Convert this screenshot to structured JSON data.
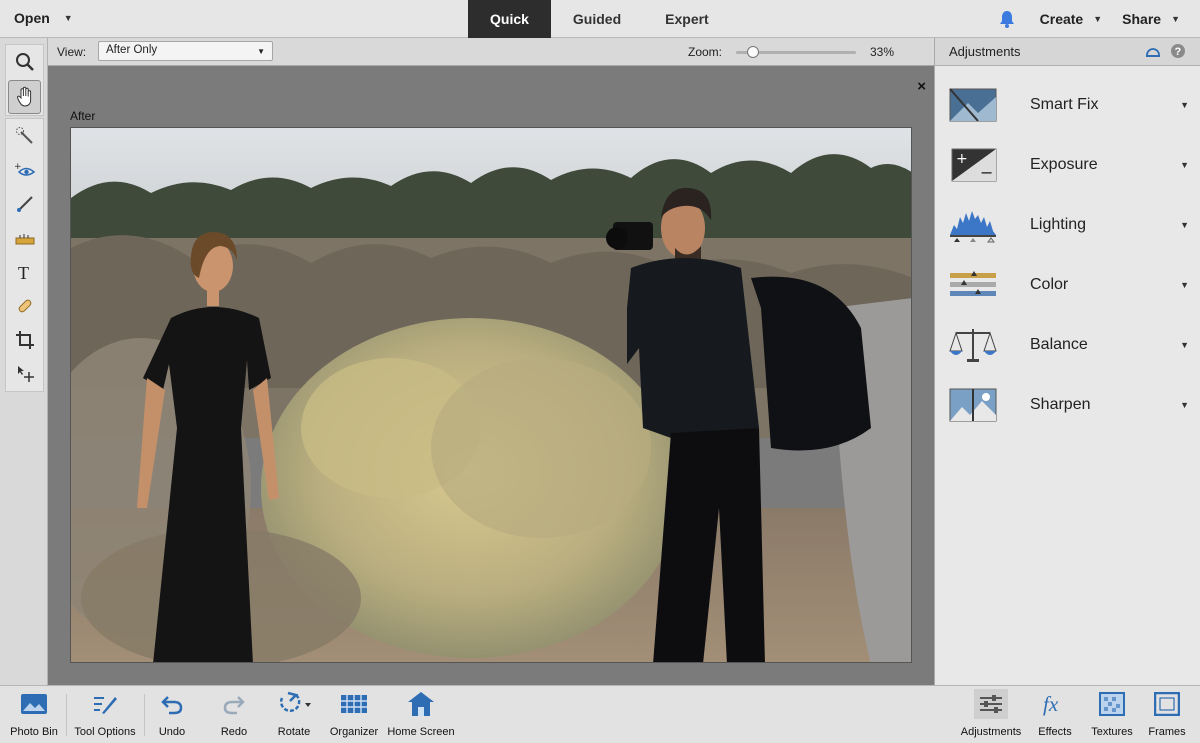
{
  "menubar": {
    "open_label": "Open",
    "mode_tabs": [
      {
        "label": "Quick",
        "active": true
      },
      {
        "label": "Guided",
        "active": false
      },
      {
        "label": "Expert",
        "active": false
      }
    ],
    "create_label": "Create",
    "share_label": "Share"
  },
  "options": {
    "view_label": "View:",
    "view_value": "After Only",
    "zoom_label": "Zoom:",
    "zoom_value": "33%",
    "zoom_fraction": 0.1
  },
  "canvas": {
    "after_label": "After",
    "close_glyph": "×"
  },
  "adjustments": {
    "title": "Adjustments",
    "items": [
      {
        "label": "Smart Fix",
        "icon": "smart-fix-icon"
      },
      {
        "label": "Exposure",
        "icon": "exposure-icon"
      },
      {
        "label": "Lighting",
        "icon": "lighting-icon"
      },
      {
        "label": "Color",
        "icon": "color-icon"
      },
      {
        "label": "Balance",
        "icon": "balance-icon"
      },
      {
        "label": "Sharpen",
        "icon": "sharpen-icon"
      }
    ]
  },
  "bottombar": {
    "left": [
      {
        "label": "Photo Bin",
        "icon": "photo-bin-icon"
      },
      {
        "label": "Tool Options",
        "icon": "tool-options-icon"
      },
      {
        "label": "Undo",
        "icon": "undo-icon"
      },
      {
        "label": "Redo",
        "icon": "redo-icon"
      },
      {
        "label": "Rotate",
        "icon": "rotate-icon"
      },
      {
        "label": "Organizer",
        "icon": "organizer-icon"
      },
      {
        "label": "Home Screen",
        "icon": "home-screen-icon"
      }
    ],
    "right": [
      {
        "label": "Adjustments",
        "icon": "adjustments-icon"
      },
      {
        "label": "Effects",
        "icon": "effects-icon"
      },
      {
        "label": "Textures",
        "icon": "textures-icon"
      },
      {
        "label": "Frames",
        "icon": "frames-icon"
      }
    ]
  },
  "colors": {
    "active_tab": "#2d2d2d",
    "bell": "#3b7be0",
    "icon_blue": "#2e6db4"
  }
}
